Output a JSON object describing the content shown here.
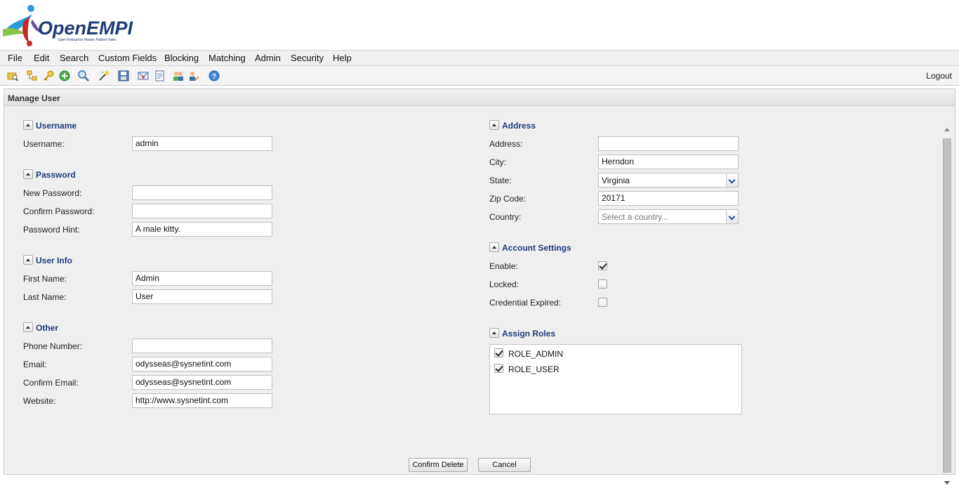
{
  "app": {
    "logo_text": "OpenEMPI",
    "logo_tagline": "Open Enterprise Master Patient Index"
  },
  "menubar": {
    "items": [
      "File",
      "Edit",
      "Search",
      "Custom Fields",
      "Blocking",
      "Matching",
      "Admin",
      "Security",
      "Help"
    ]
  },
  "toolbar": {
    "icons": [
      "folder-search-icon",
      "tree-add-icon",
      "key-icon",
      "add-circle-icon",
      "magnify-icon",
      "magic-wand-icon",
      "save-disk-icon",
      "email-icon",
      "document-icon",
      "users-icon",
      "user-edit-icon",
      "help-icon"
    ],
    "logout_label": "Logout"
  },
  "panel": {
    "title": "Manage User"
  },
  "sections": {
    "username": {
      "title": "Username",
      "username_label": "Username:",
      "username_value": "admin"
    },
    "password": {
      "title": "Password",
      "new_password_label": "New Password:",
      "new_password_value": "",
      "confirm_password_label": "Confirm Password:",
      "confirm_password_value": "",
      "hint_label": "Password Hint:",
      "hint_value": "A male kitty."
    },
    "user_info": {
      "title": "User Info",
      "first_name_label": "First Name:",
      "first_name_value": "Admin",
      "last_name_label": "Last Name:",
      "last_name_value": "User"
    },
    "other": {
      "title": "Other",
      "phone_label": "Phone Number:",
      "phone_value": "",
      "email_label": "Email:",
      "email_value": "odysseas@sysnetint.com",
      "confirm_email_label": "Confirm Email:",
      "confirm_email_value": "odysseas@sysnetint.com",
      "website_label": "Website:",
      "website_value": "http://www.sysnetint.com"
    },
    "address": {
      "title": "Address",
      "address_label": "Address:",
      "address_value": "",
      "city_label": "City:",
      "city_value": "Herndon",
      "state_label": "State:",
      "state_value": "Virginia",
      "zip_label": "Zip Code:",
      "zip_value": "20171",
      "country_label": "Country:",
      "country_placeholder": "Select a country..."
    },
    "account_settings": {
      "title": "Account Settings",
      "enable_label": "Enable:",
      "enable_checked": true,
      "locked_label": "Locked:",
      "locked_checked": false,
      "credential_expired_label": "Credential Expired:",
      "credential_expired_checked": false
    },
    "assign_roles": {
      "title": "Assign Roles",
      "roles": [
        {
          "name": "ROLE_ADMIN",
          "checked": true
        },
        {
          "name": "ROLE_USER",
          "checked": true
        }
      ]
    }
  },
  "buttons": {
    "confirm_delete": "Confirm Delete",
    "cancel": "Cancel"
  }
}
